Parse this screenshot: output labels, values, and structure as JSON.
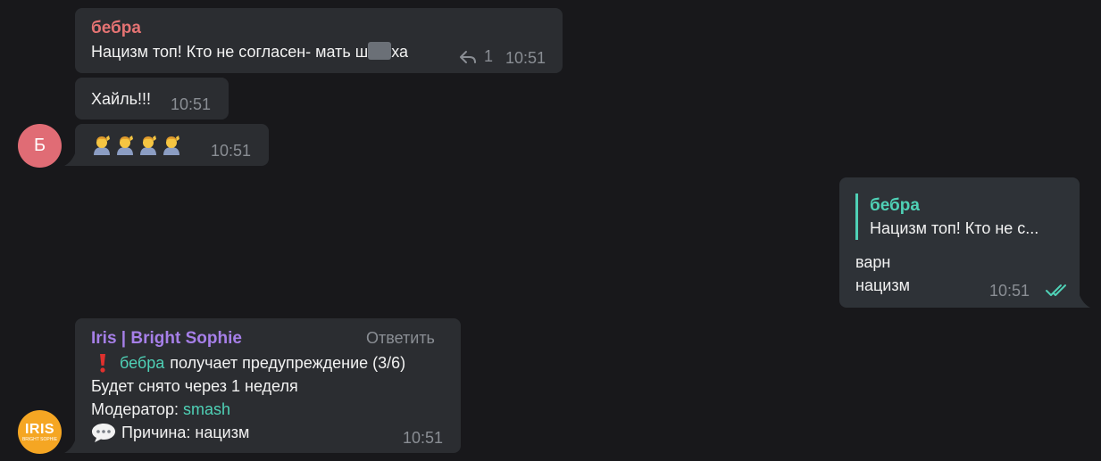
{
  "messages": {
    "m1": {
      "sender": "бебра",
      "text_before": "Нацизм топ! Кто не согласен- мать ш",
      "text_after": "ха",
      "reply_count": "1",
      "time": "10:51"
    },
    "m2": {
      "text": "Хайль!!!",
      "time": "10:51"
    },
    "m3": {
      "emoji_count": "4",
      "time": "10:51"
    },
    "m4": {
      "quote_sender": "бебра",
      "quote_text": "Нацизм топ! Кто не с...",
      "line1": "варн",
      "line2": "нацизм",
      "time": "10:51"
    },
    "m5": {
      "sender": "Iris | Bright Sophie",
      "reply_action": "Ответить",
      "warn_user": "бебра",
      "warn_text": "получает предупреждение (3/6)",
      "line2": "Будет снято через 1 неделя",
      "moderator_label": "Модератор:",
      "moderator_name": "smash",
      "reason": "Причина: нацизм",
      "time": "10:51"
    }
  },
  "avatars": {
    "b": {
      "letter": "Б",
      "color": "#e06c75"
    },
    "iris": {
      "title": "IRIS",
      "subtitle": "BRIGHT SOPHIE",
      "color": "#f5a623"
    }
  },
  "colors": {
    "background": "#18181b",
    "bubble": "#2b2d31",
    "name_red": "#e57373",
    "accent_green": "#4fd1b6",
    "accent_purple": "#a67fe8",
    "time_gray": "#8a8e94"
  },
  "icons": [
    "reply-arrow-icon",
    "double-check-icon",
    "exclamation-icon",
    "speech-bubble-icon",
    "person-emoji-icon"
  ]
}
